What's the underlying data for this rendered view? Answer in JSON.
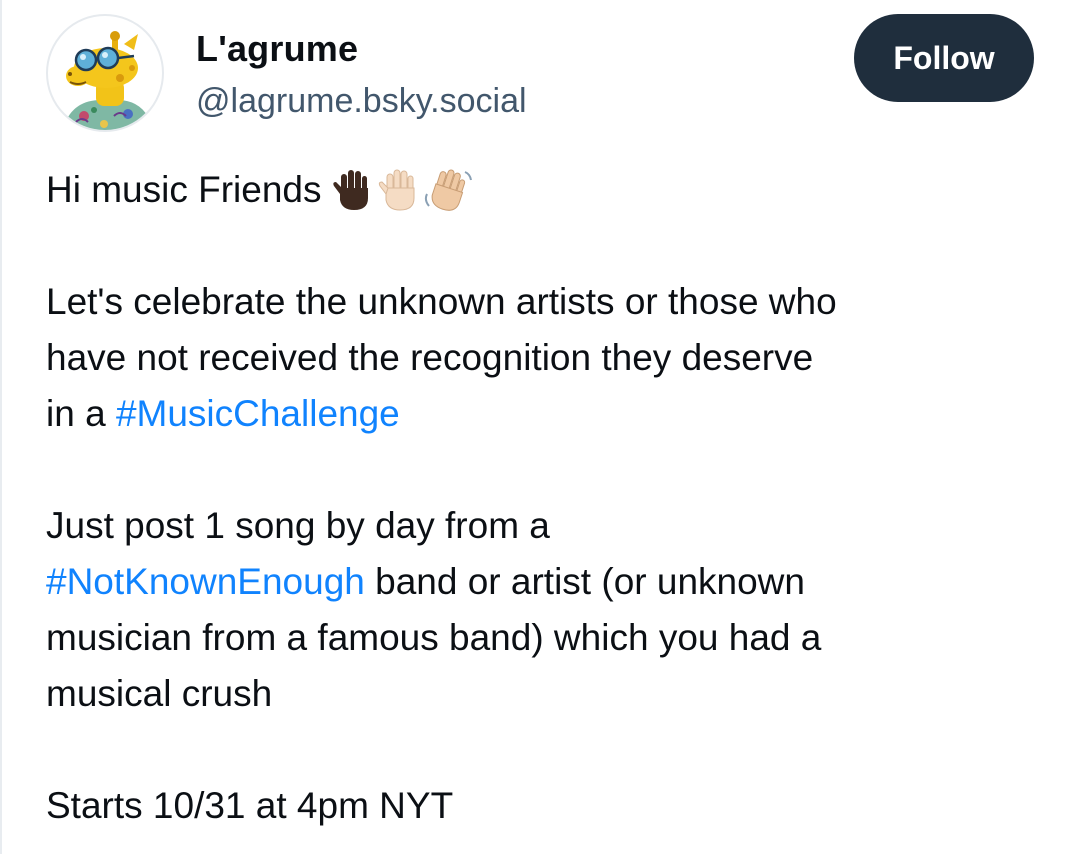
{
  "author": {
    "display_name": "L'agrume",
    "handle": "@lagrume.bsky.social",
    "avatar": "giraffe-with-sunglasses-avatar"
  },
  "follow_button": {
    "label": "Follow"
  },
  "post": {
    "greeting": "Hi music Friends",
    "greeting_emojis": [
      "raised-hand-dark-emoji",
      "raised-hand-light-emoji",
      "waving-hand-emoji"
    ],
    "paragraph1": {
      "line1": "Let's celebrate the unknown artists or those who",
      "line2": "have not received the recognition they deserve",
      "line3_prefix": "in a ",
      "line3_hashtag": "#MusicChallenge"
    },
    "paragraph2": {
      "line1": "Just post 1 song by day from a",
      "line2_hashtag": "#NotKnownEnough",
      "line2_suffix": " band or artist (or unknown",
      "line3": "musician from a famous band) which you had a",
      "line4": "musical crush"
    },
    "paragraph3": {
      "line1": "Starts 10/31 at 4pm NYT"
    }
  },
  "colors": {
    "text": "#0b0f14",
    "handle": "#42576c",
    "hashtag": "#1083fe",
    "follow_bg": "#1f2e3d",
    "follow_text": "#ffffff"
  }
}
